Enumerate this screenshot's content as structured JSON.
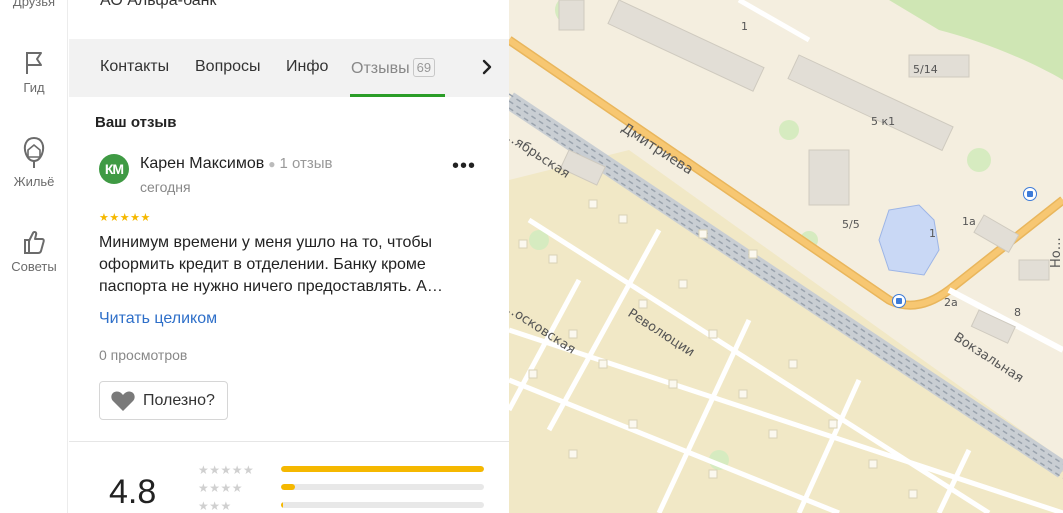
{
  "rail": {
    "items": [
      {
        "label": "Друзья"
      },
      {
        "label": "Гид"
      },
      {
        "label": "Жильё"
      },
      {
        "label": "Советы"
      }
    ]
  },
  "org": {
    "name": "АО Альфа-банк"
  },
  "tabs": {
    "items": [
      {
        "label": "Контакты"
      },
      {
        "label": "Вопросы"
      },
      {
        "label": "Инфо"
      },
      {
        "label": "Отзывы",
        "count": "69"
      }
    ],
    "active": "Отзывы"
  },
  "review": {
    "section_title": "Ваш отзыв",
    "avatar_initials": "КМ",
    "author": "Карен Максимов",
    "author_reviews": "1 отзыв",
    "date": "сегодня",
    "rating": 5,
    "stars_text": "★★★★★",
    "text": "Минимум времени у меня ушло на то, чтобы оформить кредит в отделении. Банку кроме паспорта не нужно ничего предоставлять. А…",
    "read_more": "Читать целиком",
    "views": "0 просмотров",
    "helpful_label": "Полезно?"
  },
  "summary": {
    "rating": "4.8",
    "distribution": [
      {
        "stars": "★★★★★",
        "fraction": 1.0
      },
      {
        "stars": "★★★★",
        "fraction": 0.07
      },
      {
        "stars": "★★★",
        "fraction": 0.01
      }
    ]
  },
  "map": {
    "streets": [
      {
        "name": "Дмитриева"
      },
      {
        "name": "Революции"
      },
      {
        "name": "Вокзальная"
      },
      {
        "name": "…ябрьская"
      },
      {
        "name": "…осковская"
      },
      {
        "name": "Но…"
      }
    ],
    "house_numbers": [
      "1",
      "5/14",
      "5 к1",
      "5/5",
      "1",
      "1а",
      "2а",
      "8"
    ],
    "colors": {
      "background": "#f4eedf",
      "block": "#f1e8c6",
      "road_main": "#f7c772",
      "road_minor": "#ffffff",
      "railway": "#9aa3ad",
      "park": "#cfe6b4",
      "water": "#cfe6b4",
      "building": "#e2ded6",
      "building_highlight": "#c9d8f5",
      "bus_stop": "#3d7bd8"
    }
  }
}
